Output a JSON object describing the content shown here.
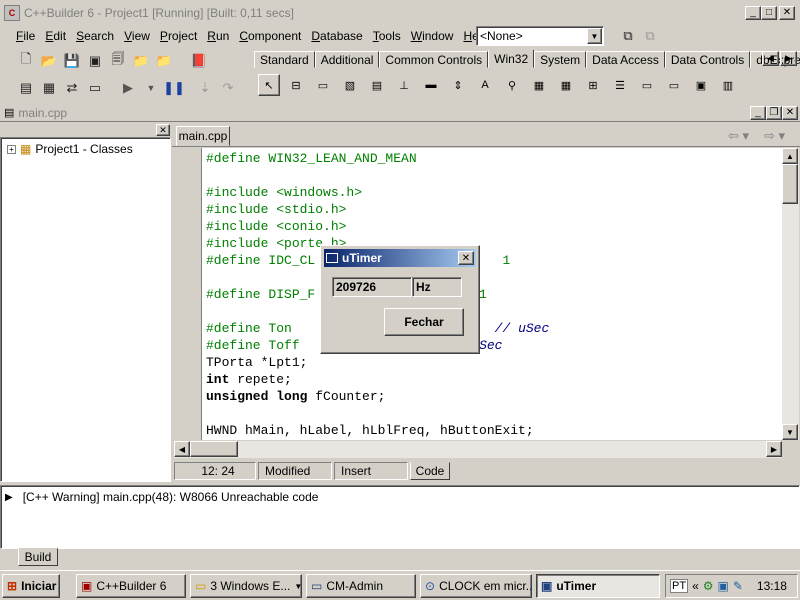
{
  "app": {
    "title": "C++Builder 6 - Project1 [Running] [Built: 0,11 secs]",
    "window_buttons": [
      "_",
      "□",
      "✕"
    ]
  },
  "menu": [
    "File",
    "Edit",
    "Search",
    "View",
    "Project",
    "Run",
    "Component",
    "Database",
    "Tools",
    "Window",
    "Help"
  ],
  "config_combo": {
    "value": "<None>"
  },
  "palette": {
    "tabs": [
      "Standard",
      "Additional",
      "Common Controls",
      "Win32",
      "System",
      "Data Access",
      "Data Controls",
      "dbExpress"
    ],
    "active_tab": "Win32"
  },
  "editor": {
    "window_title": "main.cpp",
    "tab_label": "main.cpp",
    "class_tree": {
      "root": "Project1 - Classes"
    },
    "code_lines": [
      {
        "segs": [
          {
            "t": "#define WIN32_LEAN_AND_MEAN",
            "c": "g"
          }
        ]
      },
      {
        "segs": []
      },
      {
        "segs": [
          {
            "t": "#include <windows.h>",
            "c": "g"
          }
        ]
      },
      {
        "segs": [
          {
            "t": "#include <stdio.h>",
            "c": "g"
          }
        ]
      },
      {
        "segs": [
          {
            "t": "#include <conio.h>",
            "c": "g"
          }
        ]
      },
      {
        "segs": [
          {
            "t": "#include <porte.h>",
            "c": "g"
          }
        ]
      },
      {
        "segs": [
          {
            "t": "#define IDC_CL",
            "c": "g"
          },
          {
            "t": "                        1",
            "c": "g"
          }
        ]
      },
      {
        "segs": []
      },
      {
        "segs": [
          {
            "t": "#define DISP_F",
            "c": "g"
          },
          {
            "t": "                     1",
            "c": "g"
          }
        ]
      },
      {
        "segs": []
      },
      {
        "segs": [
          {
            "t": "#define Ton",
            "c": "g"
          },
          {
            "t": "                          ",
            "c": ""
          },
          {
            "t": "// uSec",
            "c": "it"
          }
        ]
      },
      {
        "segs": [
          {
            "t": "#define Toff",
            "c": "g"
          },
          {
            "t": "                      ",
            "c": ""
          },
          {
            "t": "uSec",
            "c": "it"
          }
        ]
      },
      {
        "segs": [
          {
            "t": "TPorta *Lpt1;",
            "c": ""
          }
        ]
      },
      {
        "segs": [
          {
            "t": "int",
            "c": "b"
          },
          {
            "t": " repete;",
            "c": ""
          }
        ]
      },
      {
        "segs": [
          {
            "t": "unsigned long",
            "c": "b"
          },
          {
            "t": " fCounter;",
            "c": ""
          }
        ]
      },
      {
        "segs": []
      },
      {
        "segs": [
          {
            "t": "HWND hMain, hLabel, hLblFreq, hButtonExit;",
            "c": ""
          }
        ]
      }
    ],
    "status": {
      "position": "12:  24",
      "modified": "Modified",
      "mode": "Insert",
      "view_tab": "Code"
    }
  },
  "messages": {
    "lines": [
      "[C++ Warning] main.cpp(48): W8066 Unreachable code"
    ],
    "tab": "Build"
  },
  "dialog": {
    "title": "uTimer",
    "frequency_value": "209726",
    "unit": "Hz",
    "close_button": "Fechar"
  },
  "taskbar": {
    "start": "Iniciar",
    "items": [
      {
        "label": "C++Builder 6",
        "pressed": false
      },
      {
        "label": "3 Windows E...",
        "pressed": false
      },
      {
        "label": "CM-Admin",
        "pressed": false
      },
      {
        "label": "CLOCK em micr...",
        "pressed": false
      },
      {
        "label": "uTimer",
        "pressed": true
      }
    ],
    "lang": "PT",
    "clock": "13:18"
  },
  "colors": {
    "title_active": "#0a246a",
    "code_green": "#008000",
    "face": "#d4d0c8"
  }
}
